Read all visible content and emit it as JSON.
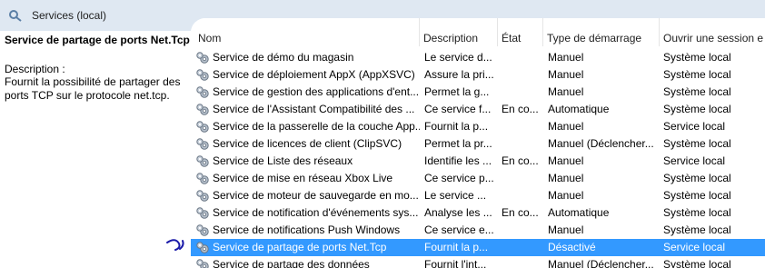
{
  "window": {
    "title": "Services (local)"
  },
  "detail": {
    "service_name": "Service de partage de ports Net.Tcp",
    "description_label": "Description :",
    "description_text": "Fournit la possibilité de partager des ports TCP sur le protocole net.tcp."
  },
  "columns": {
    "name": "Nom",
    "description": "Description",
    "state": "État",
    "startup": "Type de démarrage",
    "logon": "Ouvrir une session e"
  },
  "rows": [
    {
      "name": "Service de démo du magasin",
      "description": "Le service d...",
      "state": "",
      "startup": "Manuel",
      "logon": "Système local"
    },
    {
      "name": "Service de déploiement AppX (AppXSVC)",
      "description": "Assure la pri...",
      "state": "",
      "startup": "Manuel",
      "logon": "Système local"
    },
    {
      "name": "Service de gestion des applications d'ent...",
      "description": "Permet la g...",
      "state": "",
      "startup": "Manuel",
      "logon": "Système local"
    },
    {
      "name": "Service de l'Assistant Compatibilité des ...",
      "description": "Ce service f...",
      "state": "En co...",
      "startup": "Automatique",
      "logon": "Système local"
    },
    {
      "name": "Service de la passerelle de la couche App...",
      "description": "Fournit la p...",
      "state": "",
      "startup": "Manuel",
      "logon": "Service local"
    },
    {
      "name": "Service de licences de client (ClipSVC)",
      "description": "Permet la pr...",
      "state": "",
      "startup": "Manuel (Déclencher...",
      "logon": "Système local"
    },
    {
      "name": "Service de Liste des réseaux",
      "description": "Identifie les ...",
      "state": "En co...",
      "startup": "Manuel",
      "logon": "Service local"
    },
    {
      "name": "Service de mise en réseau Xbox Live",
      "description": "Ce service p...",
      "state": "",
      "startup": "Manuel",
      "logon": "Système local"
    },
    {
      "name": "Service de moteur de sauvegarde en mo...",
      "description": "Le service ...",
      "state": "",
      "startup": "Manuel",
      "logon": "Système local"
    },
    {
      "name": "Service de notification d'événements sys...",
      "description": "Analyse les ...",
      "state": "En co...",
      "startup": "Automatique",
      "logon": "Système local"
    },
    {
      "name": "Service de notifications Push Windows",
      "description": "Ce service e...",
      "state": "",
      "startup": "Manuel",
      "logon": "Système local"
    },
    {
      "name": "Service de partage de ports Net.Tcp",
      "description": "Fournit la p...",
      "state": "",
      "startup": "Désactivé",
      "logon": "Service local"
    },
    {
      "name": "Service de partage des données",
      "description": "Fournit l'int...",
      "state": "",
      "startup": "Manuel (Déclencher...",
      "logon": "Système local"
    }
  ],
  "selected_index": 11,
  "colors": {
    "selection": "#3399ff",
    "titlebar": "#dfe8f2",
    "annotation": "#1a1aa8"
  },
  "icons": {
    "title": "services-icon",
    "row": "gear-icon",
    "annotation": "hand-drawn-arrow-icon"
  }
}
